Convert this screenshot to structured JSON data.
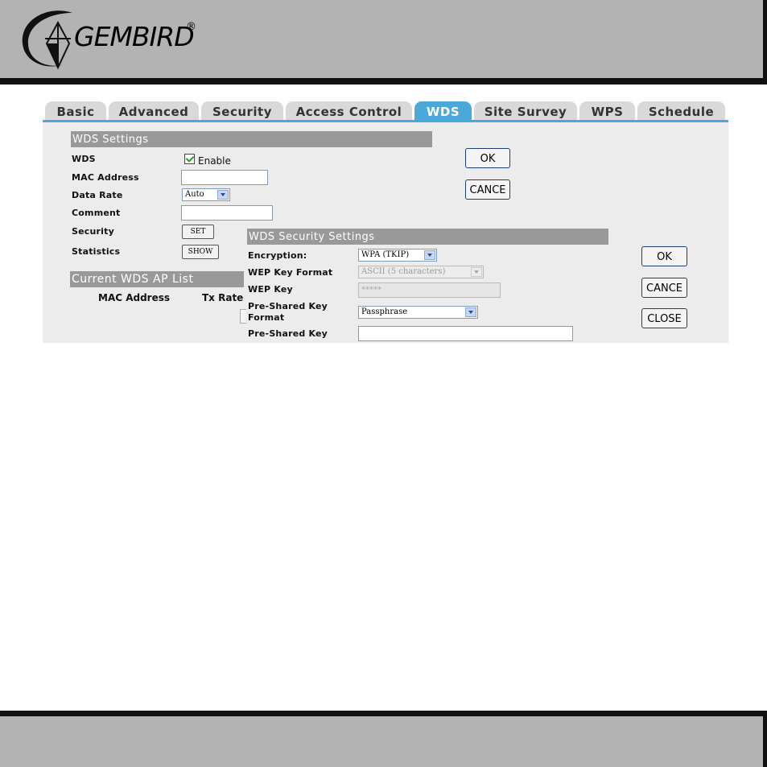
{
  "header": {
    "logo_text": "GEMBIRD",
    "logo_reg": "®"
  },
  "tabs": [
    {
      "label": "Basic"
    },
    {
      "label": "Advanced"
    },
    {
      "label": "Security"
    },
    {
      "label": "Access Control"
    },
    {
      "label": "WDS"
    },
    {
      "label": "Site Survey"
    },
    {
      "label": "WPS"
    },
    {
      "label": "Schedule"
    }
  ],
  "active_tab": "WDS",
  "wds_settings": {
    "title": "WDS Settings",
    "wds_label": "WDS",
    "enable_label": "Enable",
    "mac_label": "MAC Address",
    "mac_value": "",
    "rate_label": "Data Rate",
    "rate_value": "Auto",
    "comment_label": "Comment",
    "comment_value": "",
    "security_label": "Security",
    "set_button": "SET",
    "statistics_label": "Statistics",
    "show_button": "SHOW",
    "ok_button": "OK",
    "cancel_button": "CANCE"
  },
  "ap_list": {
    "title": "Current WDS AP List",
    "col_mac": "MAC Address",
    "col_rate": "Tx Rate"
  },
  "security_settings": {
    "title": "WDS Security Settings",
    "encryption_label": "Encryption:",
    "encryption_value": "WPA (TKIP)",
    "wep_format_label": "WEP Key Format",
    "wep_format_value": "ASCII (5 characters)",
    "wep_key_label": "WEP Key",
    "wep_key_value": "*****",
    "psk_format_label_1": "Pre-Shared Key",
    "psk_format_label_2": "Format",
    "psk_format_value": "Passphrase",
    "psk_label": "Pre-Shared Key",
    "psk_value": "",
    "ok_button": "OK",
    "cancel_button": "CANCE",
    "close_button": "CLOSE"
  }
}
